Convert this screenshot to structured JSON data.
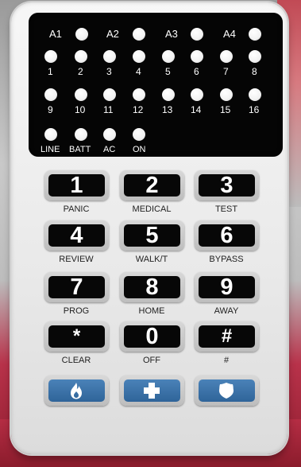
{
  "colors": {
    "display": "#050505",
    "led": "#ffffff",
    "key_face": "#070707",
    "emergency_face": "#3b74aa"
  },
  "zones": {
    "area_labels": [
      "A1",
      "A2",
      "A3",
      "A4"
    ],
    "row1": [
      "1",
      "2",
      "3",
      "4",
      "5",
      "6",
      "7",
      "8"
    ],
    "row2": [
      "9",
      "10",
      "11",
      "12",
      "13",
      "14",
      "15",
      "16"
    ],
    "status": [
      "LINE",
      "BATT",
      "AC",
      "ON"
    ]
  },
  "keys": [
    {
      "main": "1",
      "sub": "PANIC"
    },
    {
      "main": "2",
      "sub": "MEDICAL"
    },
    {
      "main": "3",
      "sub": "TEST"
    },
    {
      "main": "4",
      "sub": "REVIEW"
    },
    {
      "main": "5",
      "sub": "WALK/T"
    },
    {
      "main": "6",
      "sub": "BYPASS"
    },
    {
      "main": "7",
      "sub": "PROG"
    },
    {
      "main": "8",
      "sub": "HOME"
    },
    {
      "main": "9",
      "sub": "AWAY"
    },
    {
      "main": "*",
      "sub": "CLEAR"
    },
    {
      "main": "0",
      "sub": "OFF"
    },
    {
      "main": "#",
      "sub": "#"
    }
  ],
  "emergency": [
    {
      "icon": "fire-icon"
    },
    {
      "icon": "medical-cross-icon"
    },
    {
      "icon": "police-badge-icon"
    }
  ]
}
